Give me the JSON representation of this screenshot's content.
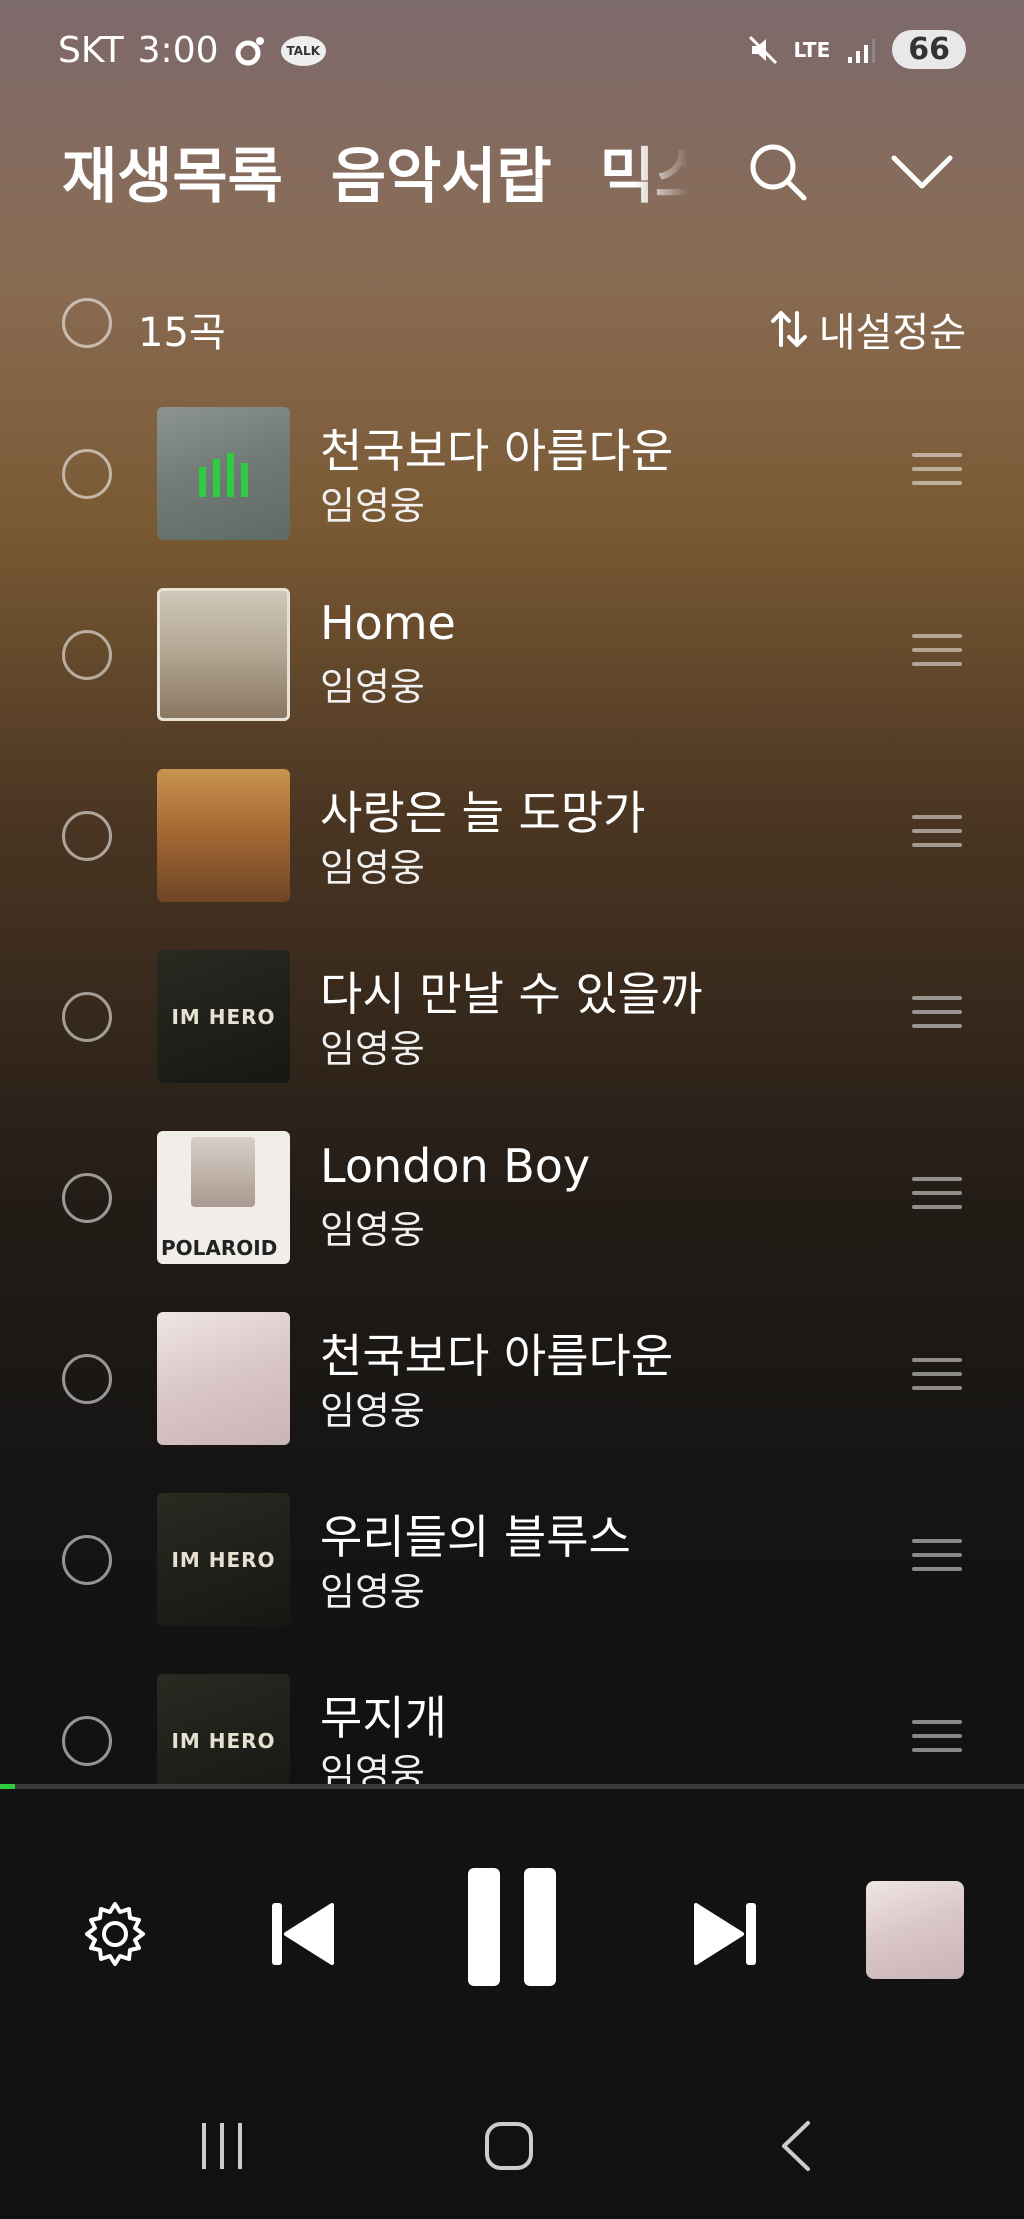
{
  "status": {
    "carrier": "SKT",
    "time": "3:00",
    "talk_badge": "TALK",
    "network": "LTE",
    "battery": "66"
  },
  "tabs": [
    {
      "label": "재생목록"
    },
    {
      "label": "음악서랍"
    },
    {
      "label": "믹스"
    }
  ],
  "list_header": {
    "count": "15곡",
    "sort_label": "내설정순"
  },
  "songs": [
    {
      "title": "천국보다 아름다운",
      "artist": "임영웅",
      "now_playing": true
    },
    {
      "title": "Home",
      "artist": "임영웅"
    },
    {
      "title": "사랑은 늘 도망가",
      "artist": "임영웅"
    },
    {
      "title": "다시 만날 수 있을까",
      "artist": "임영웅"
    },
    {
      "title": "London Boy",
      "artist": "임영웅",
      "thumb_text": "POLAROID"
    },
    {
      "title": "천국보다 아름다운",
      "artist": "임영웅"
    },
    {
      "title": "우리들의 블루스",
      "artist": "임영웅",
      "thumb_text": "IM HERO"
    },
    {
      "title": "무지개",
      "artist": "임영웅",
      "thumb_text": "IM HERO"
    }
  ],
  "album_art_text": {
    "im_hero": "IM HERO"
  },
  "playback": {
    "progress": 0.015,
    "state": "playing"
  },
  "colors": {
    "accent": "#2ecc40",
    "player_bg": "#121212"
  },
  "icons": [
    "search-icon",
    "chevron-down-icon",
    "sort-icon",
    "settings-icon",
    "previous-icon",
    "pause-icon",
    "next-icon",
    "recents-icon",
    "home-icon",
    "back-icon"
  ]
}
